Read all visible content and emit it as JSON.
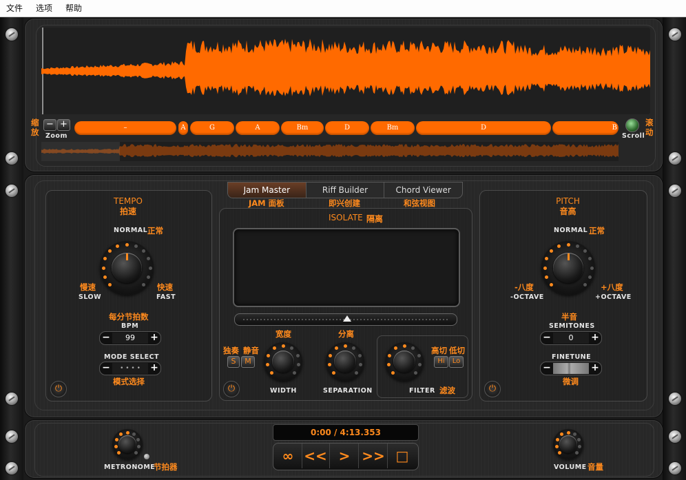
{
  "menu": {
    "file": "文件",
    "options": "选项",
    "help": "帮助"
  },
  "waveform": {
    "zoom_cn_1": "缩",
    "zoom_cn_2": "放",
    "zoom_label": "Zoom",
    "scroll_cn_1": "滚",
    "scroll_cn_2": "动",
    "scroll_label": "Scroll",
    "chords": [
      {
        "label": "–"
      },
      {
        "label": "A"
      },
      {
        "label": "G"
      },
      {
        "label": "A"
      },
      {
        "label": "Bm"
      },
      {
        "label": "D"
      },
      {
        "label": "Bm"
      },
      {
        "label": "D"
      },
      {
        "label": ""
      },
      {
        "label": "B"
      }
    ],
    "accent": "#ff6a00"
  },
  "tempo": {
    "title": "TEMPO",
    "title_cn": "拍速",
    "normal": "NORMAL",
    "normal_cn": "正常",
    "slow": "SLOW",
    "slow_cn": "慢速",
    "fast": "FAST",
    "fast_cn": "快速",
    "bpm_cn": "每分节拍数",
    "bpm": "BPM",
    "bpm_value": "99",
    "mode_select": "MODE SELECT",
    "mode_cn": "模式选择",
    "mode_value": "• • • •"
  },
  "tabs": {
    "jam": "Jam Master",
    "riff": "Riff Builder",
    "chord": "Chord Viewer",
    "jam_cn": "JAM 面板",
    "riff_cn": "即兴创建",
    "chord_cn": "和弦视图"
  },
  "isolate": {
    "title": "ISOLATE",
    "title_cn": "隔离",
    "solo_cn": "独奏",
    "mute_cn": "静音",
    "solo": "S",
    "mute": "M",
    "width_cn": "宽度",
    "width": "WIDTH",
    "separation_cn": "分离",
    "separation": "SEPARATION",
    "hicut_cn": "高切",
    "locut_cn": "低切",
    "hi": "Hi",
    "lo": "Lo",
    "filter": "FILTER",
    "filter_cn": "滤波"
  },
  "pitch": {
    "title": "PITCH",
    "title_cn": "音高",
    "normal": "NORMAL",
    "normal_cn": "正常",
    "minus_oct_cn": "-八度",
    "minus_oct": "-OCTAVE",
    "plus_oct_cn": "+八度",
    "plus_oct": "+OCTAVE",
    "semitones_cn": "半音",
    "semitones": "SEMITONES",
    "semitones_value": "0",
    "finetune": "FINETUNE",
    "finetune_cn": "微调"
  },
  "transport": {
    "time": "0:00 / 4:13.353",
    "loop": "∞",
    "rewind": "<<",
    "play": ">",
    "forward": ">>",
    "stop": "□"
  },
  "metronome": {
    "label": "METRONOME",
    "label_cn": "节拍器"
  },
  "volume": {
    "label": "VOLUME",
    "label_cn": "音量"
  }
}
